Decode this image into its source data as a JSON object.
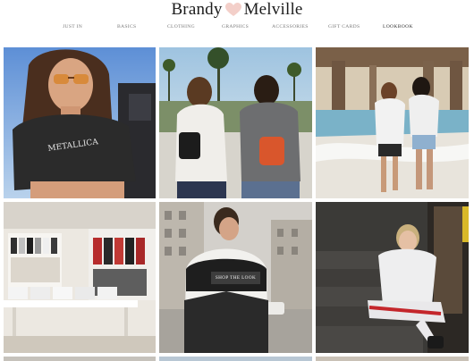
{
  "brand": {
    "part1": "Brandy",
    "part2": "Melville",
    "heart_color": "#f3cfc9"
  },
  "nav": {
    "items": [
      "JUST IN",
      "BASICS",
      "CLOTHING",
      "GRAPHICS",
      "ACCESSORIES",
      "GIFT CARDS",
      "LOOKBOOK"
    ]
  },
  "grid": {
    "shop_button_label": "SHOP THE LOOK",
    "shirt_text": "METALLICA"
  }
}
